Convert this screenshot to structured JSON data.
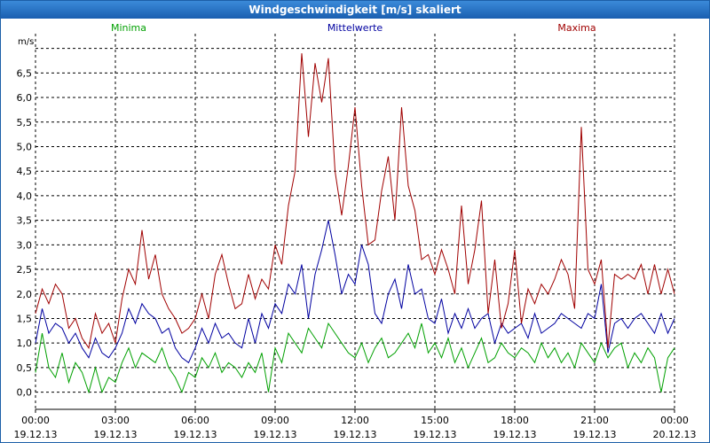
{
  "window": {
    "title": "Windgeschwindigkeit [m/s] skaliert"
  },
  "chart_data": {
    "type": "line",
    "title": "Windgeschwindigkeit [m/s] skaliert",
    "ylabel": "m/s",
    "ylim": [
      -0.35,
      7.3
    ],
    "xlim": [
      0,
      24
    ],
    "grid": true,
    "legend": "top",
    "y_ticks": [
      "0,0",
      "0,5",
      "1,0",
      "1,5",
      "2,0",
      "2,5",
      "3,0",
      "3,5",
      "4,0",
      "4,5",
      "5,0",
      "5,5",
      "6,0",
      "6,5"
    ],
    "x_ticks": [
      {
        "time": "00:00",
        "date": "19.12.13"
      },
      {
        "time": "03:00",
        "date": "19.12.13"
      },
      {
        "time": "06:00",
        "date": "19.12.13"
      },
      {
        "time": "09:00",
        "date": "19.12.13"
      },
      {
        "time": "12:00",
        "date": "19.12.13"
      },
      {
        "time": "15:00",
        "date": "19.12.13"
      },
      {
        "time": "18:00",
        "date": "19.12.13"
      },
      {
        "time": "21:00",
        "date": "19.12.13"
      },
      {
        "time": "00:00",
        "date": "20.12.13"
      }
    ],
    "series": [
      {
        "name": "Minima",
        "color": "#00a000",
        "x": [
          0,
          0.25,
          0.5,
          0.75,
          1,
          1.25,
          1.5,
          1.75,
          2,
          2.25,
          2.5,
          2.75,
          3,
          3.25,
          3.5,
          3.75,
          4,
          4.25,
          4.5,
          4.75,
          5,
          5.25,
          5.5,
          5.75,
          6,
          6.25,
          6.5,
          6.75,
          7,
          7.25,
          7.5,
          7.75,
          8,
          8.25,
          8.5,
          8.75,
          9,
          9.25,
          9.5,
          9.75,
          10,
          10.25,
          10.5,
          10.75,
          11,
          11.25,
          11.5,
          11.75,
          12,
          12.25,
          12.5,
          12.75,
          13,
          13.25,
          13.5,
          13.75,
          14,
          14.25,
          14.5,
          14.75,
          15,
          15.25,
          15.5,
          15.75,
          16,
          16.25,
          16.5,
          16.75,
          17,
          17.25,
          17.5,
          17.75,
          18,
          18.25,
          18.5,
          18.75,
          19,
          19.25,
          19.5,
          19.75,
          20,
          20.25,
          20.5,
          20.75,
          21,
          21.25,
          21.5,
          21.75,
          22,
          22.25,
          22.5,
          22.75,
          23,
          23.25,
          23.5,
          23.75,
          24
        ],
        "y": [
          0.4,
          1.2,
          0.5,
          0.3,
          0.8,
          0.2,
          0.6,
          0.4,
          0.0,
          0.5,
          0.0,
          0.3,
          0.2,
          0.6,
          0.9,
          0.5,
          0.8,
          0.7,
          0.6,
          0.9,
          0.5,
          0.3,
          0.0,
          0.4,
          0.3,
          0.7,
          0.5,
          0.8,
          0.4,
          0.6,
          0.5,
          0.3,
          0.6,
          0.4,
          0.8,
          0.0,
          0.9,
          0.6,
          1.2,
          1.0,
          0.8,
          1.3,
          1.1,
          0.9,
          1.4,
          1.2,
          1.0,
          0.8,
          0.7,
          1.0,
          0.6,
          0.9,
          1.1,
          0.7,
          0.8,
          1.0,
          1.2,
          0.9,
          1.4,
          0.8,
          1.0,
          0.7,
          1.1,
          0.6,
          0.9,
          0.5,
          0.8,
          1.1,
          0.6,
          0.7,
          1.0,
          0.8,
          0.7,
          0.9,
          0.8,
          0.6,
          1.0,
          0.7,
          0.9,
          0.6,
          0.8,
          0.5,
          1.0,
          0.8,
          0.6,
          1.0,
          0.7,
          0.9,
          1.0,
          0.5,
          0.8,
          0.6,
          0.9,
          0.7,
          0.0,
          0.7,
          0.9
        ]
      },
      {
        "name": "Mittelwerte",
        "color": "#0000a0",
        "x": [
          0,
          0.25,
          0.5,
          0.75,
          1,
          1.25,
          1.5,
          1.75,
          2,
          2.25,
          2.5,
          2.75,
          3,
          3.25,
          3.5,
          3.75,
          4,
          4.25,
          4.5,
          4.75,
          5,
          5.25,
          5.5,
          5.75,
          6,
          6.25,
          6.5,
          6.75,
          7,
          7.25,
          7.5,
          7.75,
          8,
          8.25,
          8.5,
          8.75,
          9,
          9.25,
          9.5,
          9.75,
          10,
          10.25,
          10.5,
          10.75,
          11,
          11.25,
          11.5,
          11.75,
          12,
          12.25,
          12.5,
          12.75,
          13,
          13.25,
          13.5,
          13.75,
          14,
          14.25,
          14.5,
          14.75,
          15,
          15.25,
          15.5,
          15.75,
          16,
          16.25,
          16.5,
          16.75,
          17,
          17.25,
          17.5,
          17.75,
          18,
          18.25,
          18.5,
          18.75,
          19,
          19.25,
          19.5,
          19.75,
          20,
          20.25,
          20.5,
          20.75,
          21,
          21.25,
          21.5,
          21.75,
          22,
          22.25,
          22.5,
          22.75,
          23,
          23.25,
          23.5,
          23.75,
          24
        ],
        "y": [
          1.0,
          1.7,
          1.2,
          1.4,
          1.3,
          1.0,
          1.2,
          0.9,
          0.7,
          1.1,
          0.8,
          0.7,
          0.9,
          1.2,
          1.7,
          1.4,
          1.8,
          1.6,
          1.5,
          1.2,
          1.3,
          0.9,
          0.7,
          0.6,
          0.9,
          1.3,
          1.0,
          1.4,
          1.1,
          1.2,
          1.0,
          0.9,
          1.5,
          1.0,
          1.6,
          1.3,
          1.8,
          1.6,
          2.2,
          2.0,
          2.6,
          1.5,
          2.4,
          2.9,
          3.5,
          2.8,
          2.0,
          2.4,
          2.2,
          3.0,
          2.6,
          1.6,
          1.4,
          2.0,
          2.3,
          1.7,
          2.6,
          2.0,
          2.1,
          1.5,
          1.4,
          1.9,
          1.2,
          1.6,
          1.3,
          1.7,
          1.3,
          1.5,
          1.6,
          1.0,
          1.4,
          1.2,
          1.3,
          1.4,
          1.1,
          1.6,
          1.2,
          1.3,
          1.4,
          1.6,
          1.5,
          1.4,
          1.3,
          1.6,
          1.5,
          2.2,
          0.8,
          1.4,
          1.5,
          1.3,
          1.5,
          1.6,
          1.4,
          1.2,
          1.6,
          1.2,
          1.5
        ]
      },
      {
        "name": "Maxima",
        "color": "#a00000",
        "x": [
          0,
          0.25,
          0.5,
          0.75,
          1,
          1.25,
          1.5,
          1.75,
          2,
          2.25,
          2.5,
          2.75,
          3,
          3.25,
          3.5,
          3.75,
          4,
          4.25,
          4.5,
          4.75,
          5,
          5.25,
          5.5,
          5.75,
          6,
          6.25,
          6.5,
          6.75,
          7,
          7.25,
          7.5,
          7.75,
          8,
          8.25,
          8.5,
          8.75,
          9,
          9.25,
          9.5,
          9.75,
          10,
          10.25,
          10.5,
          10.75,
          11,
          11.25,
          11.5,
          11.75,
          12,
          12.25,
          12.5,
          12.75,
          13,
          13.25,
          13.5,
          13.75,
          14,
          14.25,
          14.5,
          14.75,
          15,
          15.25,
          15.5,
          15.75,
          16,
          16.25,
          16.5,
          16.75,
          17,
          17.25,
          17.5,
          17.75,
          18,
          18.25,
          18.5,
          18.75,
          19,
          19.25,
          19.5,
          19.75,
          20,
          20.25,
          20.5,
          20.75,
          21,
          21.25,
          21.5,
          21.75,
          22,
          22.25,
          22.5,
          22.75,
          23,
          23.25,
          23.5,
          23.75,
          24
        ],
        "y": [
          1.6,
          2.1,
          1.8,
          2.2,
          2.0,
          1.3,
          1.5,
          1.1,
          0.9,
          1.6,
          1.2,
          1.4,
          1.0,
          1.9,
          2.5,
          2.2,
          3.3,
          2.3,
          2.8,
          2.0,
          1.7,
          1.5,
          1.2,
          1.3,
          1.5,
          2.0,
          1.5,
          2.4,
          2.8,
          2.2,
          1.7,
          1.8,
          2.4,
          1.9,
          2.3,
          2.1,
          3.0,
          2.6,
          3.8,
          4.5,
          6.9,
          5.2,
          6.7,
          5.9,
          6.8,
          4.5,
          3.6,
          4.6,
          5.8,
          4.2,
          3.0,
          3.1,
          4.1,
          4.8,
          3.5,
          5.8,
          4.2,
          3.7,
          2.7,
          2.8,
          2.4,
          2.9,
          2.5,
          2.0,
          3.8,
          2.2,
          2.9,
          3.9,
          1.6,
          2.7,
          1.3,
          1.8,
          2.9,
          1.4,
          2.1,
          1.8,
          2.2,
          2.0,
          2.3,
          2.7,
          2.4,
          1.7,
          5.4,
          2.5,
          2.2,
          2.7,
          0.9,
          2.4,
          2.3,
          2.4,
          2.3,
          2.6,
          2.0,
          2.6,
          2.0,
          2.5,
          2.0
        ]
      }
    ]
  }
}
